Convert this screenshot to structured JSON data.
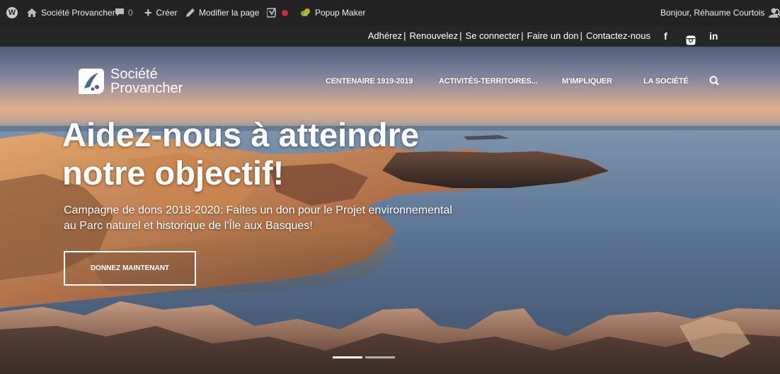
{
  "admin_bar": {
    "site_name": "Société Provancher",
    "comments_count": "0",
    "create_label": "Créer",
    "edit_label": "Modifier la page",
    "popup_label": "Popup Maker",
    "greeting": "Bonjour, Réhaume Courtois"
  },
  "top_links": [
    "Adhérez",
    "Renouvelez",
    "Se connecter",
    "Faire un don",
    "Contactez-nous"
  ],
  "social": {
    "facebook": "f",
    "linkedin": "in"
  },
  "logo": {
    "line1": "Société",
    "line2": "Provancher"
  },
  "main_nav": [
    "CENTENAIRE 1919-2019",
    "ACTIVITÉS-TERRITOIRES...",
    "M'IMPLIQUER",
    "LA SOCIÉTÉ"
  ],
  "hero": {
    "headline_line1": "Aidez-nous à atteindre",
    "headline_line2": "notre objectif!",
    "subtext_line1": "Campagne de dons 2018-2020: Faites un don pour le Projet environnemental",
    "subtext_line2": "au Parc naturel et historique de l'Île aux Basques!",
    "cta_label": "DONNEZ MAINTENANT"
  },
  "icons": [
    "wordpress-logo-icon",
    "home-icon",
    "comment-icon",
    "plus-icon",
    "pencil-icon",
    "yoast-icon",
    "record-dot-icon",
    "popup-maker-icon",
    "user-icon",
    "search-icon",
    "facebook-icon",
    "instagram-icon",
    "linkedin-icon"
  ],
  "colors": {
    "admin_bar_bg": "#232323",
    "top_nav_bg": "#262626",
    "red_dot": "#e0262b"
  }
}
